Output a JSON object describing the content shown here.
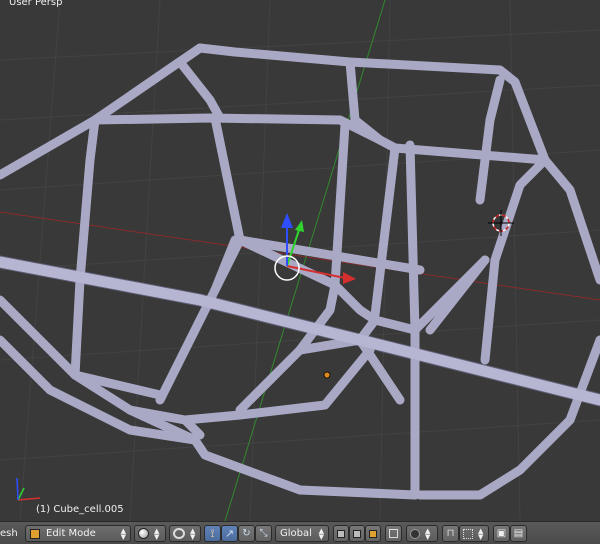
{
  "viewport": {
    "view_name": "User Persp",
    "object_name": "(1) Cube_cell.005"
  },
  "header": {
    "editor_label": "esh",
    "mode": "Edit Mode",
    "orientation": "Global"
  },
  "colors": {
    "background": "#393939",
    "grid": "#444444",
    "frame": "#a7a7c4",
    "x_axis": "#d62f2f",
    "y_axis": "#2fd52f",
    "z_axis": "#2f4fff"
  }
}
